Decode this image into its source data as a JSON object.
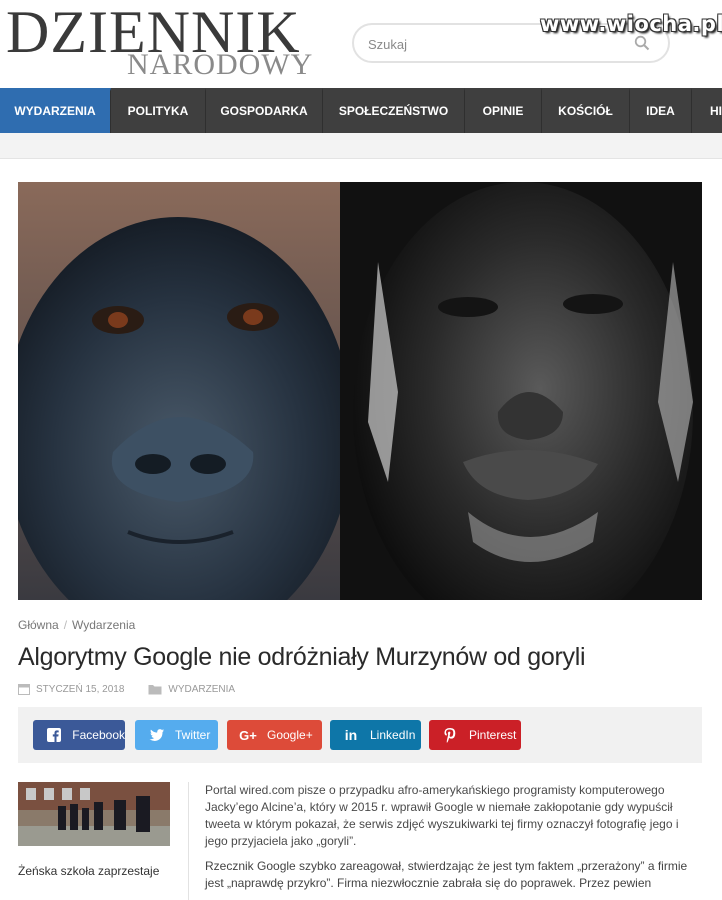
{
  "header": {
    "logo_main": "DZIENNIK",
    "logo_sub": "NARODOWY",
    "search_placeholder": "Szukaj",
    "watermark": "www.wiocha.pl"
  },
  "nav": {
    "items": [
      {
        "label": "WYDARZENIA",
        "active": true
      },
      {
        "label": "POLITYKA"
      },
      {
        "label": "GOSPODARKA"
      },
      {
        "label": "SPOŁECZEŃSTWO"
      },
      {
        "label": "OPINIE"
      },
      {
        "label": "KOŚCIÓŁ"
      },
      {
        "label": "IDEA"
      },
      {
        "label": "HI"
      }
    ]
  },
  "article": {
    "breadcrumb": [
      "Główna",
      "Wydarzenia"
    ],
    "title": "Algorytmy Google nie odróżniały Murzynów od goryli",
    "date": "STYCZEŃ 15, 2018",
    "category": "WYDARZENIA",
    "paragraphs": [
      "Portal wired.com pisze o przypadku afro-amerykańskiego programisty komputerowego Jacky’ego Alcine’a, który w 2015 r. wprawił Google w niemałe zakłopotanie gdy wypuścił tweeta w którym pokazał, że serwis zdjęć wyszukiwarki tej firmy oznaczył fotografię jego i jego przyjaciela jako „goryli”.",
      "Rzecznik Google szybko zareagował, stwierdzając że jest tym faktem „przerażony” a firmie jest „naprawdę przykro”. Firma niezwłocznie zabrała się do poprawek. Przez pewien"
    ]
  },
  "share": {
    "facebook": "Facebook",
    "twitter": "Twitter",
    "googleplus": "Google+",
    "linkedin": "LinkedIn",
    "pinterest": "Pinterest"
  },
  "related": {
    "title": "Żeńska szkoła zaprzestaje"
  },
  "colors": {
    "nav_bg": "#3f3f3f",
    "nav_active": "#2f6db0",
    "facebook": "#3b5998",
    "twitter": "#55acee",
    "googleplus": "#dd4b39",
    "linkedin": "#0e76a8",
    "pinterest": "#cb2027"
  }
}
